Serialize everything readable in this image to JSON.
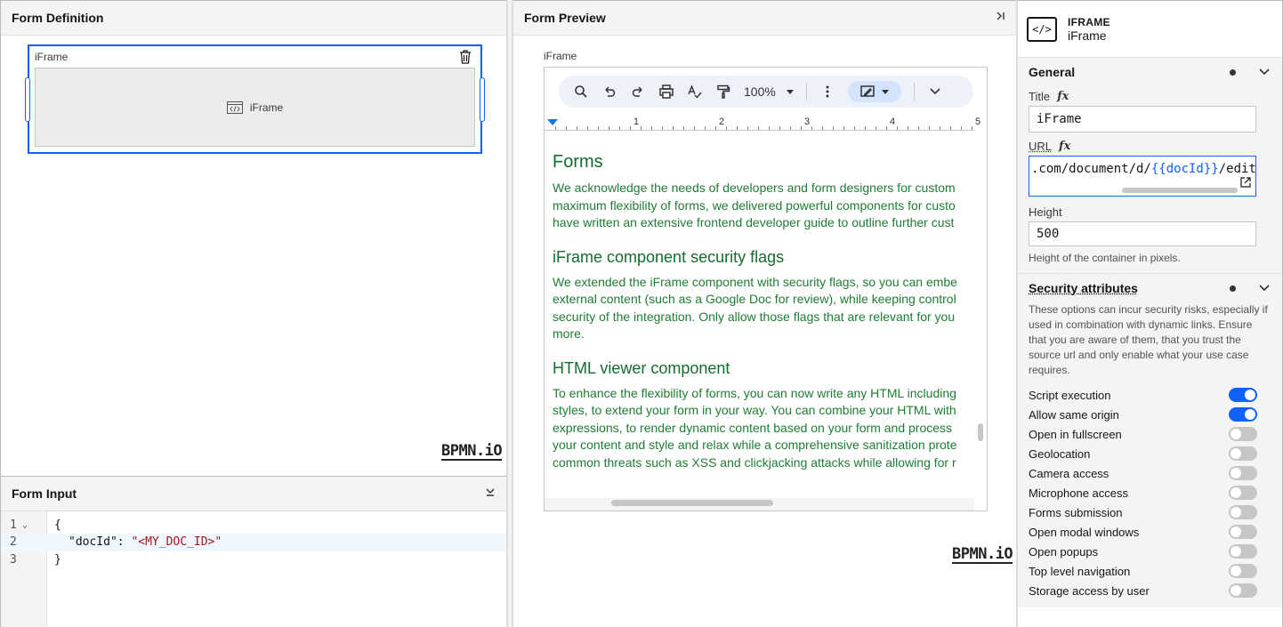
{
  "definition": {
    "title": "Form Definition",
    "field_label": "iFrame",
    "placeholder_label": "iFrame",
    "logo": "BPMN.iO"
  },
  "form_input": {
    "title": "Form Input",
    "lines": [
      {
        "num": "1",
        "text": "{"
      },
      {
        "num": "2",
        "key": "\"docId\"",
        "value": "\"<MY_DOC_ID>\""
      },
      {
        "num": "3",
        "text": "}"
      }
    ]
  },
  "preview": {
    "title": "Form Preview",
    "field_label": "iFrame",
    "logo": "BPMN.iO",
    "toolbar": {
      "zoom": "100%"
    },
    "ruler_numbers": [
      "1",
      "2",
      "3",
      "4",
      "5"
    ],
    "doc": {
      "h1": "Forms",
      "p1": [
        "We acknowledge the needs of developers and form designers for custom",
        "maximum flexibility of forms, we delivered powerful components for custo",
        "have written an extensive frontend developer guide to outline further cust"
      ],
      "h2": "iFrame component security flags",
      "p2": [
        "We extended the iFrame component with security flags, so you can embe",
        "external content (such as a Google Doc for review), while keeping control",
        "security of the integration. Only allow those flags that are relevant for you",
        "more."
      ],
      "h3": "HTML viewer component",
      "p3": [
        "To enhance the flexibility of forms, you can now write any HTML including",
        "styles, to extend your form in your way. You can combine your HTML with",
        "expressions, to render dynamic content based on your form and process",
        "your content and style and relax while a comprehensive sanitization prote",
        "common threats such as XSS and clickjacking attacks while allowing for r"
      ]
    }
  },
  "properties": {
    "type": "IFRAME",
    "name": "iFrame",
    "general": {
      "title": "General",
      "title_label": "Title",
      "title_value": "iFrame",
      "url_label": "URL",
      "url_prefix": ".com/document/d/",
      "url_template": "{{docId}}",
      "url_suffix": "/edit",
      "height_label": "Height",
      "height_value": "500",
      "height_helper": "Height of the container in pixels."
    },
    "security": {
      "title": "Security attributes",
      "description": "These options can incur security risks, especially if used in combination with dynamic links. Ensure that you are aware of them, that you trust the source url and only enable what your use case requires.",
      "toggles": [
        {
          "label": "Script execution",
          "on": true
        },
        {
          "label": "Allow same origin",
          "on": true
        },
        {
          "label": "Open in fullscreen",
          "on": false
        },
        {
          "label": "Geolocation",
          "on": false
        },
        {
          "label": "Camera access",
          "on": false
        },
        {
          "label": "Microphone access",
          "on": false
        },
        {
          "label": "Forms submission",
          "on": false
        },
        {
          "label": "Open modal windows",
          "on": false
        },
        {
          "label": "Open popups",
          "on": false
        },
        {
          "label": "Top level navigation",
          "on": false
        },
        {
          "label": "Storage access by user",
          "on": false
        }
      ]
    }
  }
}
